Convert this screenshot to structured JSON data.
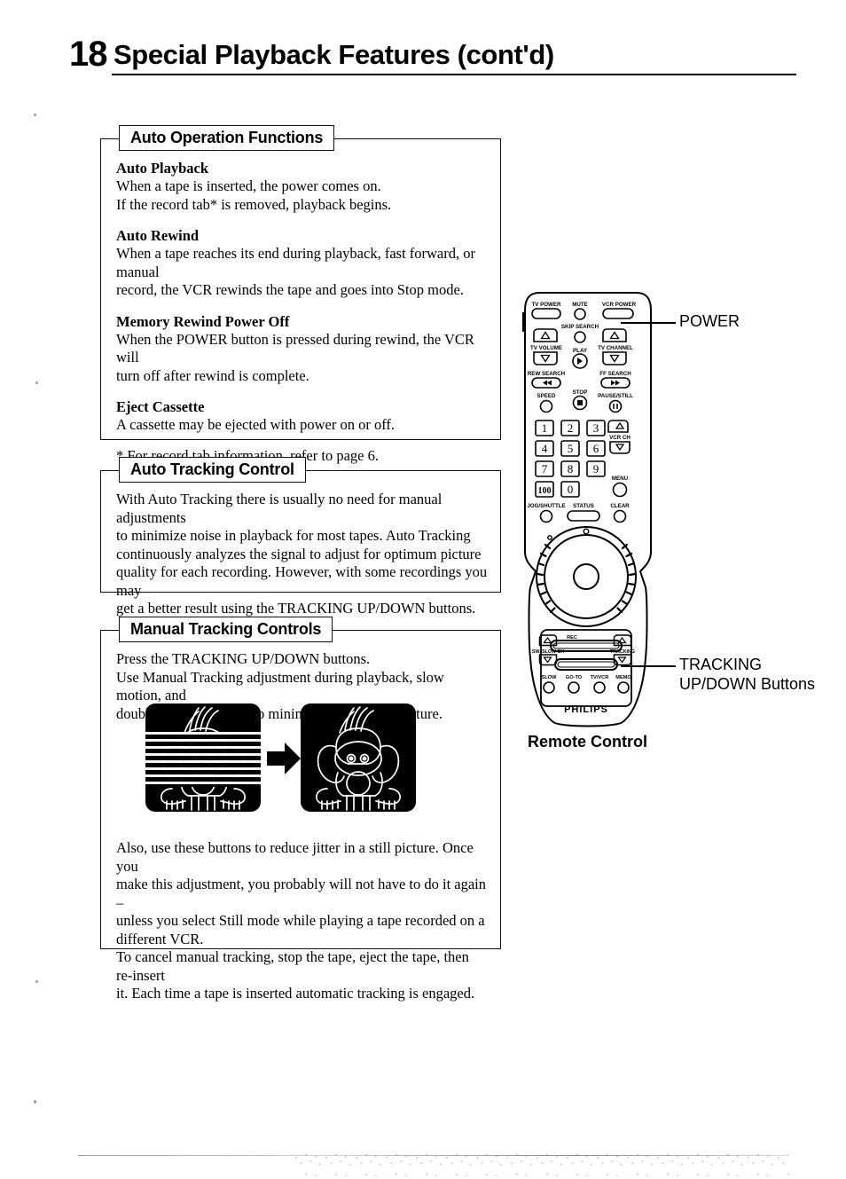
{
  "page": {
    "number": "18",
    "title": "Special Playback Features (cont'd)"
  },
  "sections": [
    {
      "heading": "Auto Operation Functions",
      "blocks": [
        {
          "subhead": "Auto Playback",
          "lines": [
            "When a tape is inserted, the power comes on.",
            "If the record tab* is removed, playback begins."
          ]
        },
        {
          "subhead": "Auto Rewind",
          "lines": [
            "When a tape reaches its end during playback, fast forward, or manual",
            "record, the VCR rewinds the tape and goes into Stop mode."
          ]
        },
        {
          "subhead": "Memory Rewind Power Off",
          "lines": [
            "When the POWER button is pressed during rewind, the VCR will",
            "turn off after rewind is complete."
          ]
        },
        {
          "subhead": "Eject Cassette",
          "lines": [
            "A cassette may be ejected with power on or off."
          ]
        }
      ],
      "footnote": "* For record tab information, refer to page 6."
    },
    {
      "heading": "Auto Tracking Control",
      "paragraph_lines": [
        "With Auto Tracking there is usually no need for manual adjustments",
        "to minimize noise in playback for most tapes. Auto Tracking",
        "continuously analyzes the signal to adjust for optimum picture",
        "quality for each recording. However, with some recordings you may",
        "get a better result using the TRACKING UP/DOWN buttons."
      ]
    },
    {
      "heading": "Manual Tracking Controls",
      "top_lines": [
        "Press the TRACKING UP/DOWN buttons.",
        "Use Manual Tracking adjustment during playback, slow motion, and",
        "double speed playback to minimize noise in the picture."
      ],
      "bottom_lines": [
        "Also, use these buttons to reduce jitter in a still picture. Once you",
        "make this adjustment, you probably will not have to do it again –",
        "unless you select Still mode while playing a tape recorded on a",
        "different VCR.",
        "To cancel manual tracking, stop the tape, eject the tape, then re-insert",
        "it. Each time a tape is inserted automatic tracking is engaged."
      ],
      "illustration": {
        "left_screen": "noisy-picture-with-tracking-lines",
        "right_screen": "clean-picture",
        "arrow": "right-arrow"
      }
    }
  ],
  "remote": {
    "caption": "Remote Control",
    "brand": "PHILIPS",
    "buttons": {
      "tv_power": "TV POWER",
      "mute": "MUTE",
      "vcr_power": "VCR POWER",
      "skip_search": "SKIP SEARCH",
      "tv_volume": "TV VOLUME",
      "tv_channel": "TV CHANNEL",
      "play": "PLAY",
      "rew_search": "REW SEARCH",
      "ff_search": "FF SEARCH",
      "speed": "SPEED",
      "stop": "STOP",
      "pause_still": "PAUSE/STILL",
      "vcr_ch": "VCR CH",
      "menu": "MENU",
      "jog_shuttle": "JOG/SHUTTLE",
      "status": "STATUS",
      "clear": "CLEAR",
      "rec": "REC",
      "sw_slow_ch": "SW. SLOW CH",
      "tracking": "TRACKING",
      "slow": "SLOW",
      "go_to": "GO-TO",
      "tv_vcr": "TV/VCR",
      "memo": "MEMO"
    },
    "keypad": [
      "1",
      "2",
      "3",
      "4",
      "5",
      "6",
      "7",
      "8",
      "9",
      "100",
      "0"
    ]
  },
  "callouts": {
    "power": "POWER",
    "tracking_line1": "TRACKING",
    "tracking_line2": "UP/DOWN Buttons"
  },
  "colors": {
    "ink": "#000000",
    "paper": "#ffffff"
  }
}
